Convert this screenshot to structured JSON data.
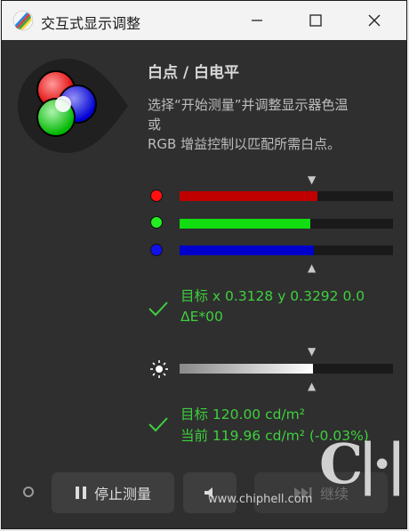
{
  "window": {
    "title": "交互式显示调整"
  },
  "header": {
    "heading": "白点 / 白电平",
    "description": "选择“开始测量”并调整显示器色温\n或\nRGB 增益控制以匹配所需白点。"
  },
  "rgb_bars": [
    {
      "channel": "red",
      "color": "#ff1010",
      "fill_color": "#c00000",
      "level": 0.645
    },
    {
      "channel": "green",
      "color": "#22ee22",
      "fill_color": "#11dd11",
      "level": 0.612
    },
    {
      "channel": "blue",
      "color": "#1111ee",
      "fill_color": "#0000cc",
      "level": 0.63
    }
  ],
  "rgb_target_marker": 0.625,
  "whitepoint_result": {
    "line1": "目标 x 0.3128 y 0.3292 0.0",
    "line2": "ΔE*00"
  },
  "luminance": {
    "level": 0.625,
    "target_marker": 0.625
  },
  "luminance_result": {
    "line1": "目标 120.00 cd/m²",
    "line2": "当前 119.96 cd/m² (-0.03%)"
  },
  "footer": {
    "stop_label": "停止测量",
    "next_label": "继续",
    "watermark": "www.chiphell.com",
    "logo_text": "chip hell"
  },
  "colors": {
    "success": "#3fcf3f",
    "panel_bg": "#2f2f2f"
  }
}
